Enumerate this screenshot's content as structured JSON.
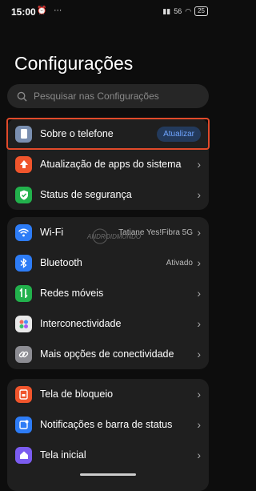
{
  "status": {
    "time": "15:00",
    "icons": "⏰ ⋯",
    "net": "56",
    "battery": "25"
  },
  "title": "Configurações",
  "search": {
    "placeholder": "Pesquisar nas Configurações"
  },
  "group1": [
    {
      "label": "Sobre o telefone",
      "badge": "Atualizar",
      "icon": "phone-icon",
      "color": "#7a8fb0"
    },
    {
      "label": "Atualização de apps do sistema",
      "icon": "arrow-up-icon",
      "color": "#f0552c"
    },
    {
      "label": "Status de segurança",
      "icon": "shield-check-icon",
      "color": "#22b14c"
    }
  ],
  "group2": [
    {
      "label": "Wi-Fi",
      "value": "Tatiane Yes!Fibra 5G",
      "icon": "wifi-icon",
      "color": "#2d7cf6"
    },
    {
      "label": "Bluetooth",
      "value": "Ativado",
      "icon": "bluetooth-icon",
      "color": "#2d7cf6"
    },
    {
      "label": "Redes móveis",
      "icon": "mobile-data-icon",
      "color": "#22b14c"
    },
    {
      "label": "Interconectividade",
      "icon": "interconnect-icon",
      "color": "#e9e9e9"
    },
    {
      "label": "Mais opções de conectividade",
      "icon": "link-icon",
      "color": "#8d8d93"
    }
  ],
  "group3": [
    {
      "label": "Tela de bloqueio",
      "icon": "lock-screen-icon",
      "color": "#f0552c"
    },
    {
      "label": "Notificações e barra de status",
      "icon": "notification-icon",
      "color": "#2d7cf6"
    },
    {
      "label": "Tela inicial",
      "icon": "home-icon",
      "color": "#7b5cf0"
    }
  ],
  "watermark": "ANDROIDMUNDO"
}
